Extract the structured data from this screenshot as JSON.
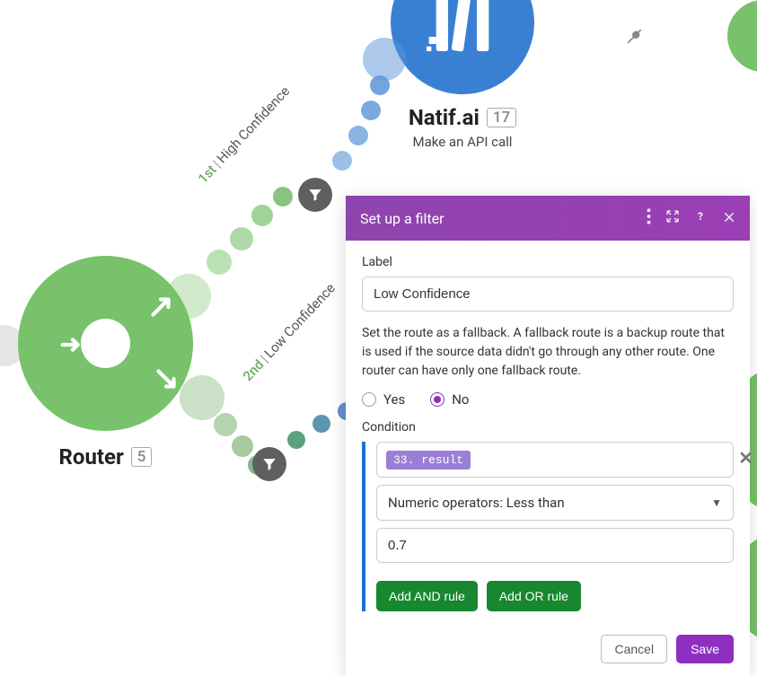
{
  "nodes": {
    "natif": {
      "title": "Natif.ai",
      "badge": "17",
      "subtitle": "Make an API call"
    },
    "router": {
      "title": "Router",
      "badge": "5"
    }
  },
  "paths": {
    "high": {
      "ordinal": "1st",
      "label": "High Confidence"
    },
    "low": {
      "ordinal": "2nd",
      "label": "Low Confidence"
    }
  },
  "panel": {
    "title": "Set up a filter",
    "label_field": "Label",
    "label_value": "Low Confidence",
    "fallback_help": "Set the route as a fallback. A fallback route is a backup route that is used if the source data didn't go through any other route. One router can have only one fallback route.",
    "radio_yes": "Yes",
    "radio_no": "No",
    "fallback_selected": "No",
    "condition_label": "Condition",
    "condition": {
      "field_chip": "33. result",
      "operator": "Numeric operators: Less than",
      "value": "0.7"
    },
    "add_and": "Add AND rule",
    "add_or": "Add OR rule",
    "cancel": "Cancel",
    "save": "Save"
  }
}
